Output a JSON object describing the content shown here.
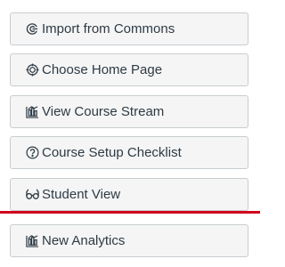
{
  "buttons": [
    {
      "label": "Import from Commons",
      "icon": "import-commons-icon"
    },
    {
      "label": "Choose Home Page",
      "icon": "target-icon"
    },
    {
      "label": "View Course Stream",
      "icon": "stream-icon"
    },
    {
      "label": "Course Setup Checklist",
      "icon": "question-circle-icon"
    },
    {
      "label": "Student View",
      "icon": "glasses-icon"
    },
    {
      "label": "New Analytics",
      "icon": "analytics-icon"
    }
  ],
  "colors": {
    "button_bg": "#f5f5f5",
    "button_border": "#c7cdd1",
    "text": "#2d3b45",
    "highlight_line": "#d0021b"
  }
}
